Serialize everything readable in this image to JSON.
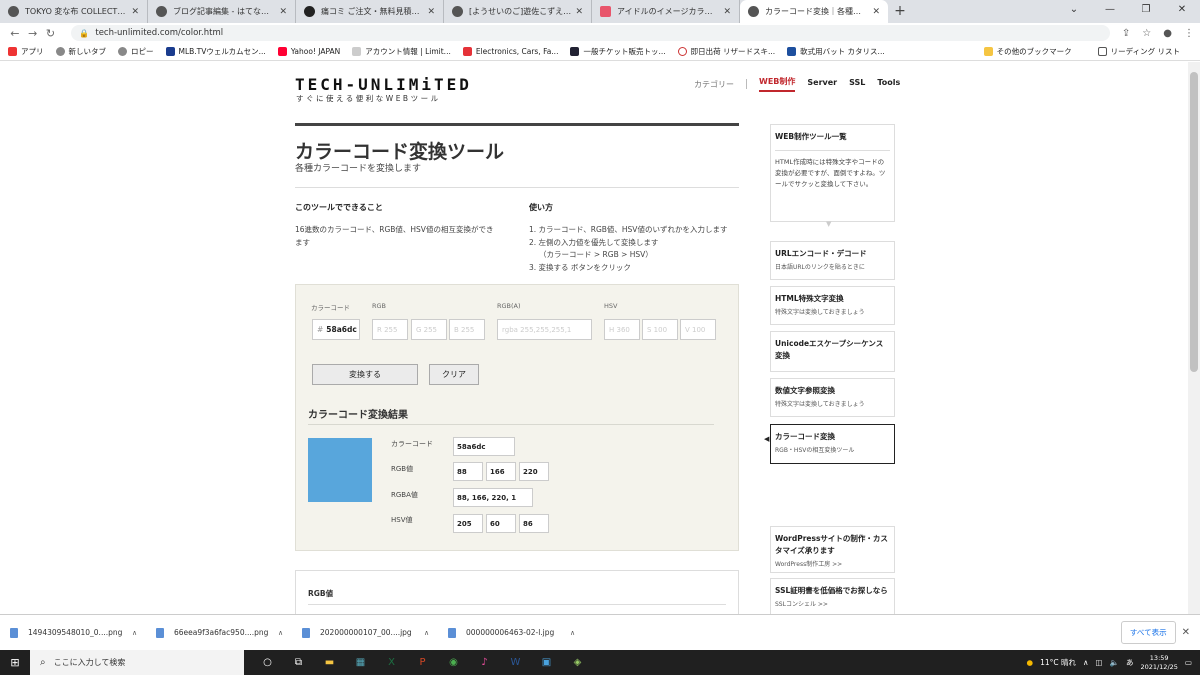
{
  "browser": {
    "tabs": [
      {
        "title": "TOKYO 変な布 COLLECTION - fuji"
      },
      {
        "title": "ブログ記事編集 - はてなブログ"
      },
      {
        "title": "痛コミ ご注文・無料見積り依頼 - S"
      },
      {
        "title": "[ようせいのご]遊佐こずえ+ | アイマス"
      },
      {
        "title": "アイドルのイメージカラー - アイマスDB"
      },
      {
        "title": "カラーコード変換｜各種設定用のカラ"
      }
    ],
    "url": "tech-unlimited.com/color.html",
    "bookmarks": [
      "アプリ",
      "新しいタブ",
      "ロピー",
      "MLB.TVウェルカムセン...",
      "Yahoo! JAPAN",
      "アカウント情報 | Limit...",
      "Electronics, Cars, Fa...",
      "一般チケット販売トッ...",
      "即日出荷 リザードスキ...",
      "軟式用バット カタリス..."
    ],
    "bookmarks_right": [
      "その他のブックマーク",
      "リーディング リスト"
    ]
  },
  "site": {
    "logo": "TECH-UNLIMiTED",
    "tagline": "すぐに使える便利なWEBツール",
    "nav": {
      "category": "カテゴリー",
      "items": [
        "WEB制作",
        "Server",
        "SSL",
        "Tools"
      ]
    },
    "title": "カラーコード変換ツール",
    "subtitle": "各種カラーコードを変換します",
    "can_do": {
      "heading": "このツールでできること",
      "text": "16進数のカラーコード、RGB値、HSV値の相互変換ができます"
    },
    "how_to": {
      "heading": "使い方",
      "steps": [
        "1. カラーコード、RGB値、HSV値のいずれかを入力します",
        "2. 左側の入力値を優先して変換します",
        "（カラーコード > RGB > HSV）",
        "3. 変換する ボタンをクリック"
      ]
    },
    "form": {
      "labels": {
        "colorcode": "カラーコード",
        "rgb": "RGB",
        "rgba": "RGB(A)",
        "hsv": "HSV"
      },
      "colorcode_prefix": "#",
      "colorcode_value": "58a6dc",
      "placeholders": {
        "r": "R 255",
        "g": "G 255",
        "b": "B 255",
        "rgba": "rgba 255,255,255,1",
        "h": "H 360",
        "s": "S 100",
        "v": "V 100"
      },
      "convert_button": "変換する",
      "clear_button": "クリア"
    },
    "result": {
      "heading": "カラーコード変換結果",
      "swatch_color": "#58a6dc",
      "colorcode_label": "カラーコード",
      "colorcode": "58a6dc",
      "rgb_label": "RGB値",
      "rgb": [
        "88",
        "166",
        "220"
      ],
      "rgba_label": "RGBA値",
      "rgba": "88, 166, 220, 1",
      "hsv_label": "HSV値",
      "hsv": [
        "205",
        "60",
        "86"
      ]
    },
    "section2_heading": "RGB値",
    "sidebar": {
      "intro_title": "WEB制作ツール一覧",
      "intro_text": "HTML作成時には特殊文字やコードの変換が必要ですが、面倒ですよね。ツールでサクッと変換して下さい。",
      "items": [
        {
          "title": "URLエンコード・デコード",
          "desc": "日本語URLのリンクを貼るときに"
        },
        {
          "title": "HTML特殊文字変換",
          "desc": "特殊文字は変換しておきましょう"
        },
        {
          "title": "Unicodeエスケープシーケンス変換",
          "desc": ""
        },
        {
          "title": "数値文字参照変換",
          "desc": "特殊文字は変換しておきましょう"
        },
        {
          "title": "カラーコード変換",
          "desc": "RGB・HSVの相互変換ツール"
        }
      ],
      "ads": [
        {
          "title": "WordPressサイトの制作・カスタマイズ承ります",
          "desc": "WordPress制作工房 >>"
        },
        {
          "title": "SSL証明書を低価格でお探しなら",
          "desc": "SSLコンシェル >>"
        }
      ]
    }
  },
  "downloads": {
    "files": [
      "1494309548010_0....png",
      "66eea9f3a6fac950....png",
      "202000000107_00....jpg",
      "000000006463-02-l.jpg"
    ],
    "show_all": "すべて表示"
  },
  "taskbar": {
    "search_placeholder": "ここに入力して検索",
    "weather": "11°C 晴れ",
    "ime": "あ",
    "time": "13:59",
    "date": "2021/12/25"
  }
}
